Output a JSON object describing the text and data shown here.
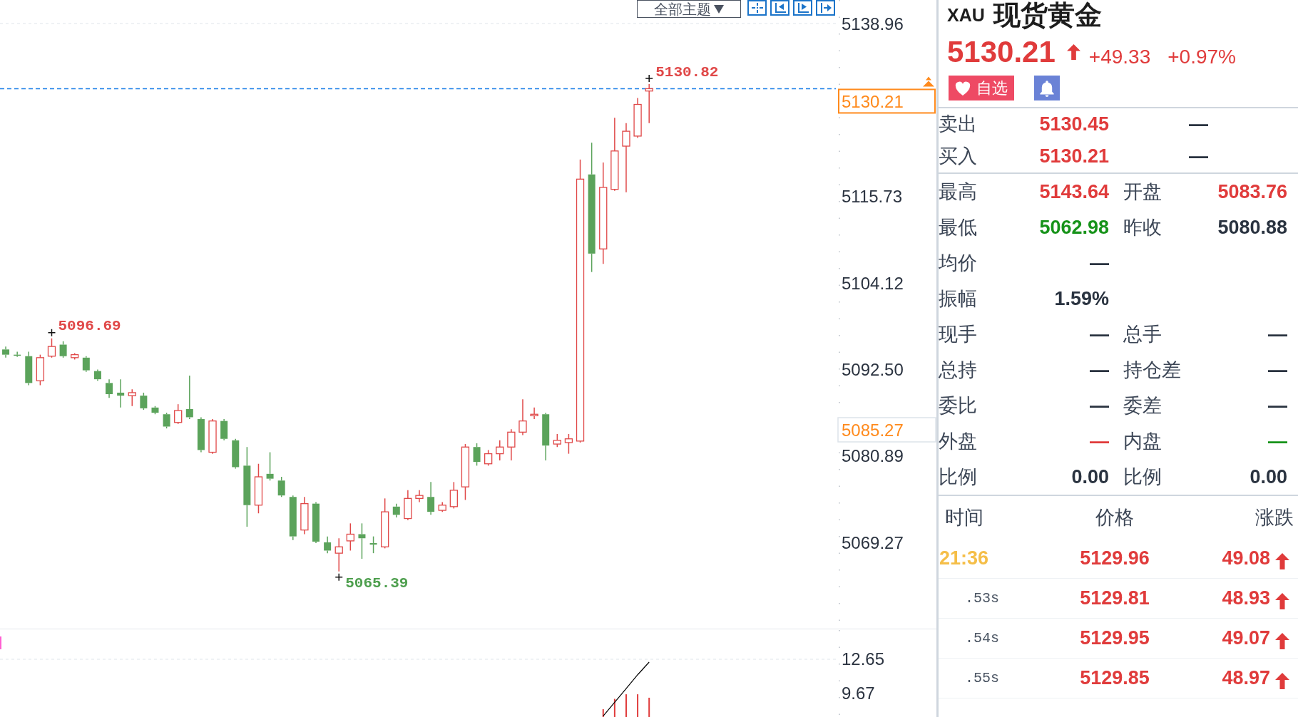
{
  "chart_toolbar": {
    "theme_button": "全部主题"
  },
  "chart": {
    "cursor_price_label": "5085.27",
    "chart_data": [
      {
        "type": "candlestick",
        "ylim": [
          5057.72,
          5142.12
        ],
        "yticks": [
          5069.27,
          5080.89,
          {
            "value": 5092.5,
            "label": "5092.50"
          },
          5104.12,
          5115.73,
          5138.96
        ],
        "ref_lines": [
          {
            "axis": "y",
            "value": 5130.21,
            "label": "5130.21",
            "color": "#1a7ee8",
            "line_style": "dashed"
          }
        ],
        "annotations": [
          "5130.82",
          "5096.69",
          "5065.39"
        ],
        "ohlc": [
          [
            5095.2,
            5095.6,
            5094.1,
            5094.5
          ],
          [
            5094.5,
            5094.9,
            5094.2,
            5094.4
          ],
          [
            5094.3,
            5094.9,
            5090.4,
            5090.7
          ],
          [
            5091.0,
            5094.5,
            5090.4,
            5094.1
          ],
          [
            5094.3,
            5096.69,
            5094.1,
            5095.6
          ],
          [
            5095.85,
            5096.3,
            5094.1,
            5094.3
          ],
          [
            5094.1,
            5094.7,
            5093.85,
            5094.5
          ],
          [
            5094.1,
            5094.3,
            5092.2,
            5092.4
          ],
          [
            5092.3,
            5092.5,
            5091.0,
            5091.2
          ],
          [
            5090.7,
            5091.2,
            5088.7,
            5089.2
          ],
          [
            5089.4,
            5091.2,
            5087.4,
            5089.0
          ],
          [
            5089.0,
            5089.85,
            5087.6,
            5089.4
          ],
          [
            5089.0,
            5089.4,
            5087.1,
            5087.3
          ],
          [
            5087.4,
            5087.6,
            5086.5,
            5086.7
          ],
          [
            5086.5,
            5086.7,
            5084.6,
            5084.85
          ],
          [
            5085.4,
            5087.85,
            5085.2,
            5087.0
          ],
          [
            5087.2,
            5091.7,
            5085.85,
            5086.1
          ],
          [
            5085.85,
            5086.1,
            5081.4,
            5081.7
          ],
          [
            5081.4,
            5085.85,
            5081.2,
            5085.6
          ],
          [
            5085.6,
            5085.85,
            5083.0,
            5083.2
          ],
          [
            5083.0,
            5083.2,
            5079.2,
            5079.4
          ],
          [
            5079.6,
            5082.1,
            5071.4,
            5074.3
          ],
          [
            5074.3,
            5079.85,
            5073.2,
            5078.1
          ],
          [
            5078.5,
            5081.4,
            5077.6,
            5077.85
          ],
          [
            5077.6,
            5078.1,
            5075.4,
            5075.6
          ],
          [
            5075.4,
            5075.6,
            5069.6,
            5070.1
          ],
          [
            5070.96,
            5075.4,
            5070.4,
            5074.5
          ],
          [
            5074.5,
            5074.7,
            5069.2,
            5069.4
          ],
          [
            5069.3,
            5070.1,
            5067.85,
            5068.2
          ],
          [
            5067.85,
            5069.85,
            5065.39,
            5068.7
          ],
          [
            5069.5,
            5071.85,
            5068.2,
            5070.4
          ],
          [
            5070.4,
            5071.85,
            5067.1,
            5069.85
          ],
          [
            5069.2,
            5070.1,
            5067.85,
            5069.0
          ],
          [
            5068.7,
            5075.2,
            5068.5,
            5073.4
          ],
          [
            5074.1,
            5074.5,
            5072.65,
            5073.0
          ],
          [
            5072.5,
            5076.3,
            5072.3,
            5075.2
          ],
          [
            5075.2,
            5076.3,
            5074.7,
            5075.6
          ],
          [
            5075.4,
            5077.4,
            5073.0,
            5073.4
          ],
          [
            5073.6,
            5074.7,
            5073.4,
            5074.3
          ],
          [
            5074.1,
            5077.4,
            5073.85,
            5076.3
          ],
          [
            5076.75,
            5082.5,
            5075.0,
            5082.1
          ],
          [
            5082.1,
            5082.6,
            5079.6,
            5080.1
          ],
          [
            5079.85,
            5081.7,
            5079.6,
            5081.2
          ],
          [
            5081.2,
            5083.0,
            5080.3,
            5082.1
          ],
          [
            5082.1,
            5084.5,
            5080.3,
            5084.1
          ],
          [
            5084.1,
            5088.5,
            5083.7,
            5085.6
          ],
          [
            5086.3,
            5087.4,
            5085.85,
            5086.5
          ],
          [
            5086.5,
            5086.7,
            5080.3,
            5082.3
          ],
          [
            5082.5,
            5083.85,
            5082.1,
            5083.0
          ],
          [
            5082.7,
            5083.85,
            5081.2,
            5083.2
          ],
          [
            5082.9,
            5120.7,
            5082.7,
            5118.07
          ],
          [
            5118.7,
            5122.96,
            5105.6,
            5108.07
          ],
          [
            5108.7,
            5120.3,
            5106.7,
            5116.96
          ],
          [
            5116.7,
            5126.3,
            5116.5,
            5121.85
          ],
          [
            5122.5,
            5125.6,
            5116.3,
            5124.5
          ],
          [
            5123.85,
            5128.96,
            5123.6,
            5128.1
          ],
          [
            5129.9,
            5130.82,
            5125.6,
            5130.21
          ],
          null,
          null,
          null,
          null,
          null,
          null,
          null,
          null,
          null,
          null,
          null,
          null,
          null,
          null,
          null,
          null
        ]
      },
      {
        "type": "bar",
        "ylim": [
          7.62,
          15.32
        ],
        "yticks": [
          9.67,
          12.65
        ],
        "series": [
          {
            "type": "bar",
            "color": "#e03c3c",
            "values": [
              null,
              null,
              null,
              null,
              null,
              null,
              null,
              null,
              null,
              null,
              null,
              null,
              null,
              null,
              null,
              null,
              null,
              null,
              null,
              null,
              null,
              null,
              null,
              null,
              null,
              null,
              null,
              null,
              null,
              null,
              null,
              null,
              null,
              null,
              null,
              null,
              null,
              null,
              null,
              null,
              null,
              null,
              null,
              null,
              null,
              null,
              null,
              null,
              null,
              null,
              null,
              null,
              8.3,
              9.2,
              9.6,
              9.6,
              9.3,
              null,
              null,
              null,
              null,
              null,
              null,
              null,
              null,
              null,
              null,
              null,
              null,
              null,
              null,
              null,
              null
            ]
          },
          {
            "type": "line",
            "color": "#000000",
            "values": [
              null,
              null,
              null,
              null,
              null,
              null,
              null,
              null,
              null,
              null,
              null,
              null,
              null,
              null,
              null,
              null,
              null,
              null,
              null,
              null,
              null,
              null,
              null,
              null,
              null,
              null,
              null,
              null,
              null,
              null,
              null,
              null,
              null,
              null,
              null,
              null,
              null,
              null,
              null,
              null,
              null,
              null,
              null,
              null,
              null,
              null,
              null,
              null,
              null,
              null,
              null,
              null,
              7.7,
              8.9,
              10.1,
              11.3,
              12.4,
              null,
              null,
              null,
              null,
              null,
              null,
              null,
              null,
              null,
              null,
              null,
              null,
              null,
              null,
              null,
              null
            ]
          }
        ]
      }
    ]
  },
  "quote": {
    "symbol": "XAU",
    "name": "现货黄金",
    "price": "5130.21",
    "rising": true,
    "change": "+49.33",
    "change_percent": "+0.97%",
    "watchlist_button": "自选"
  },
  "bid_ask": [
    {
      "label": "卖出",
      "price": "5130.45",
      "color": "#e03b3b",
      "volume": "—"
    },
    {
      "label": "买入",
      "price": "5130.21",
      "color": "#e03b3b",
      "volume": "—"
    }
  ],
  "stats": [
    {
      "cells": [
        {
          "label": "最高",
          "value": "5143.64",
          "color": "#e03b3b"
        },
        {
          "label": "开盘",
          "value": "5083.76",
          "color": "#e03b3b"
        }
      ]
    },
    {
      "cells": [
        {
          "label": "最低",
          "value": "5062.98",
          "color": "#17931a"
        },
        {
          "label": "昨收",
          "value": "5080.88",
          "color": "#2a3340"
        }
      ]
    },
    {
      "cells": [
        {
          "label": "均价",
          "value": "—",
          "color": "#2a3340"
        }
      ]
    },
    {
      "cells": [
        {
          "label": "振幅",
          "value": "1.59%",
          "color": "#2a3340"
        }
      ]
    },
    {
      "cells": [
        {
          "label": "现手",
          "value": "—",
          "color": "#2a3340"
        },
        {
          "label": "总手",
          "value": "—",
          "color": "#2a3340"
        }
      ]
    },
    {
      "cells": [
        {
          "label": "总持",
          "value": "—",
          "color": "#2a3340"
        },
        {
          "label": "持仓差",
          "value": "—",
          "color": "#2a3340"
        }
      ]
    },
    {
      "cells": [
        {
          "label": "委比",
          "value": "—",
          "color": "#2a3340"
        },
        {
          "label": "委差",
          "value": "—",
          "color": "#2a3340"
        }
      ]
    },
    {
      "cells": [
        {
          "label": "外盘",
          "value": "—",
          "color": "#e03b3b"
        },
        {
          "label": "内盘",
          "value": "—",
          "color": "#17931a"
        }
      ]
    },
    {
      "cells": [
        {
          "label": "比例",
          "value": "0.00",
          "color": "#2a3340"
        },
        {
          "label": "比例",
          "value": "0.00",
          "color": "#2a3340"
        }
      ]
    }
  ],
  "trades": {
    "columns": [
      "时间",
      "价格",
      "涨跌"
    ],
    "rows": [
      {
        "time": "21:36",
        "kind": "minute",
        "price": "5129.96",
        "change": "49.08",
        "rising": true
      },
      {
        "time": ".53s",
        "kind": "second",
        "price": "5129.81",
        "change": "48.93",
        "rising": true
      },
      {
        "time": ".54s",
        "kind": "second",
        "price": "5129.95",
        "change": "49.07",
        "rising": true
      },
      {
        "time": ".55s",
        "kind": "second",
        "price": "5129.85",
        "change": "48.97",
        "rising": true
      }
    ]
  }
}
